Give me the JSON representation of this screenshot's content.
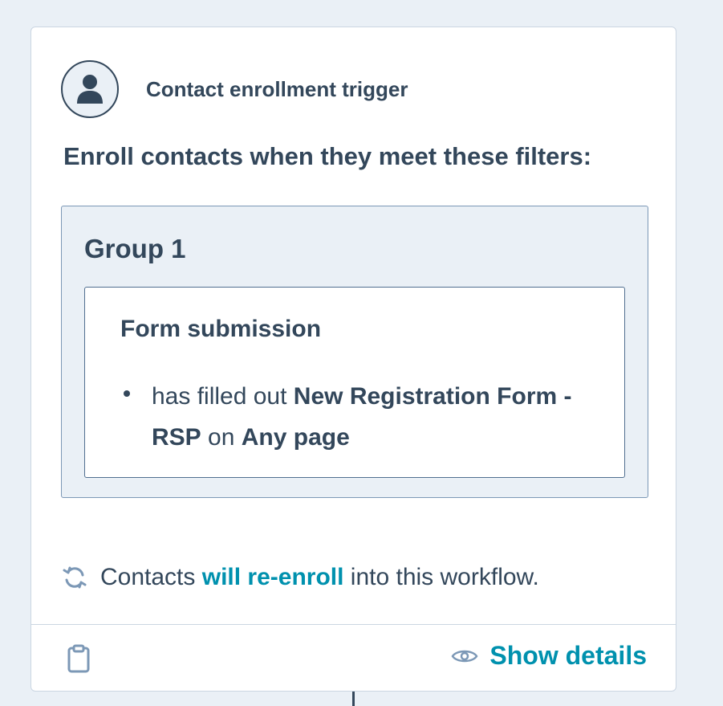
{
  "trigger": {
    "title": "Contact enrollment trigger",
    "avatar_icon": "contact-avatar-icon"
  },
  "enroll_heading": "Enroll contacts when they meet these filters:",
  "group": {
    "title": "Group 1",
    "filter": {
      "title": "Form submission",
      "prefix": "has filled out",
      "form_name": "New Registration Form - RSP",
      "connector": "on",
      "page": "Any page"
    }
  },
  "reenroll": {
    "icon": "refresh-icon",
    "prefix": "Contacts",
    "link": "will re-enroll",
    "suffix": "into this workflow."
  },
  "footer": {
    "clipboard_icon": "clipboard-icon",
    "show_details_icon": "eye-icon",
    "show_details_label": "Show details"
  },
  "colors": {
    "background": "#eaf0f6",
    "text": "#33475b",
    "link": "#0091ae",
    "border": "#cbd6e2"
  }
}
